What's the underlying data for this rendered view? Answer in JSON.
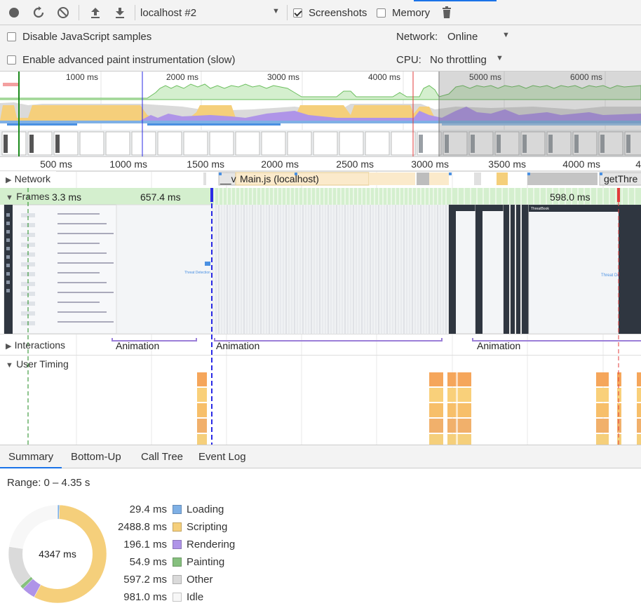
{
  "toolbar": {
    "target": "localhost #2",
    "screenshots_label": "Screenshots",
    "screenshots_checked": true,
    "memory_label": "Memory",
    "memory_checked": false
  },
  "settings": {
    "disable_js_samples": "Disable JavaScript samples",
    "enable_paint": "Enable advanced paint instrumentation (slow)",
    "network_label": "Network:",
    "network_value": "Online",
    "cpu_label": "CPU:",
    "cpu_value": "No throttling"
  },
  "overview_ticks": [
    "1000 ms",
    "2000 ms",
    "3000 ms",
    "4000 ms",
    "5000 ms",
    "6000 ms"
  ],
  "ruler_ticks": [
    "500 ms",
    "1000 ms",
    "1500 ms",
    "2000 ms",
    "2500 ms",
    "3000 ms",
    "3500 ms",
    "4000 ms",
    "4"
  ],
  "tracks": {
    "network_label": "Network",
    "network_item_1": "__v",
    "network_item_2": "Main.js (localhost)",
    "network_item_3": "getThre",
    "frames_label": "Frames",
    "frame_time_1": "3.3 ms",
    "frame_time_2": "657.4 ms",
    "frame_time_3": "598.0 ms",
    "interactions_label": "Interactions",
    "animation_labels": [
      "Animation",
      "Animation",
      "Animation"
    ],
    "user_timing_label": "User Timing",
    "screenshot_caption_1": "Threat Detection",
    "screenshot_caption_2": "Threat De",
    "app_badge": "ThreatBook"
  },
  "tabs": [
    "Summary",
    "Bottom-Up",
    "Call Tree",
    "Event Log"
  ],
  "active_tab": "Summary",
  "summary": {
    "range": "Range: 0 – 4.35 s",
    "total": "4347 ms",
    "items": [
      {
        "name": "Loading",
        "value": "29.4 ms",
        "ms": 29.4,
        "color": "#7fb0e5"
      },
      {
        "name": "Scripting",
        "value": "2488.8 ms",
        "ms": 2488.8,
        "color": "#f5cf7b"
      },
      {
        "name": "Rendering",
        "value": "196.1 ms",
        "ms": 196.1,
        "color": "#af94e8"
      },
      {
        "name": "Painting",
        "value": "54.9 ms",
        "ms": 54.9,
        "color": "#86c07e"
      },
      {
        "name": "Other",
        "value": "597.2 ms",
        "ms": 597.2,
        "color": "#dadada"
      },
      {
        "name": "Idle",
        "value": "981.0 ms",
        "ms": 981.0,
        "color": "#f7f7f7"
      }
    ]
  },
  "colors": {
    "scripting": "#f5cf7b",
    "rendering": "#af94e8",
    "painting": "#86c07e",
    "loading": "#7fb0e5",
    "frames_bg": "#d4efce",
    "network_main": "#fbeacb",
    "selection_line": "#2a2ae6",
    "red_marker": "#e23b3b",
    "green_marker": "#1c8a1c"
  }
}
